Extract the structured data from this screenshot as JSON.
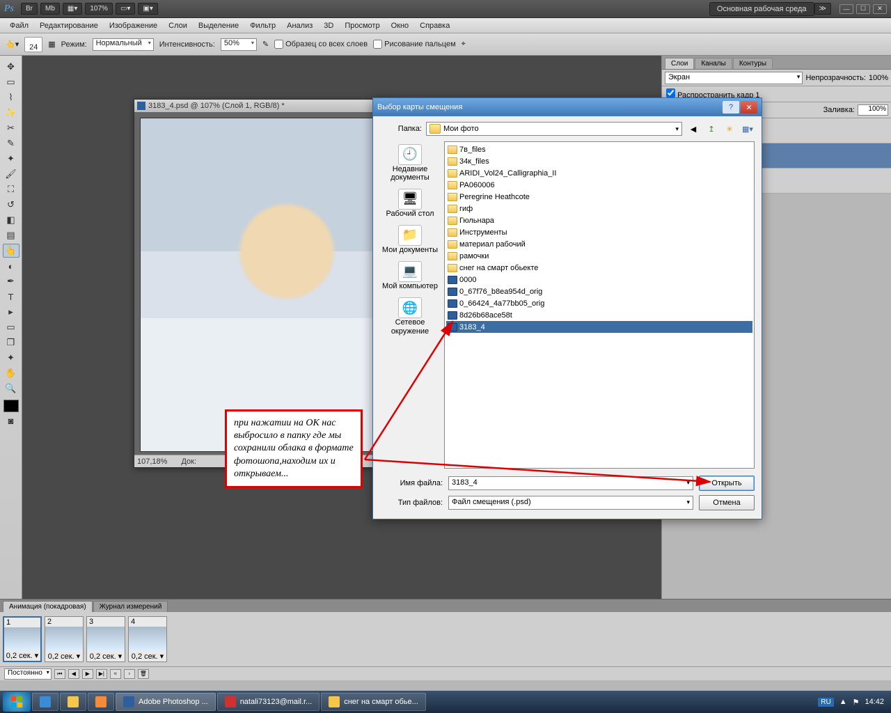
{
  "appbar": {
    "zoom": "107%",
    "workspace": "Основная рабочая среда"
  },
  "menu": [
    "Файл",
    "Редактирование",
    "Изображение",
    "Слои",
    "Выделение",
    "Фильтр",
    "Анализ",
    "3D",
    "Просмотр",
    "Окно",
    "Справка"
  ],
  "options": {
    "brush_size": "24",
    "mode_label": "Режим:",
    "mode_value": "Нормальный",
    "intensity_label": "Интенсивность:",
    "intensity_value": "50%",
    "sample_all": "Образец со всех слоев",
    "finger_paint": "Рисование пальцем"
  },
  "document": {
    "title": "3183_4.psd @ 107% (Слой 1, RGB/8) *",
    "status_zoom": "107,18%",
    "status_label": "Док:"
  },
  "layers_panel": {
    "tabs": [
      "Слои",
      "Каналы",
      "Контуры"
    ],
    "blend_mode": "Экран",
    "opacity_label": "Непрозрачность:",
    "opacity": "100%",
    "propagate": "Распространить кадр 1",
    "fill_label": "Заливка:",
    "fill": "100%",
    "layers": [
      {
        "name": ""
      },
      {
        "name": "",
        "selected": true
      },
      {
        "name": ""
      }
    ]
  },
  "dialog": {
    "title": "Выбор карты смещения",
    "folder_label": "Папка:",
    "folder_value": "Мои фото",
    "places": [
      {
        "icon": "🕘",
        "label": "Недавние документы"
      },
      {
        "icon": "🖥",
        "label": "Рабочий стол"
      },
      {
        "icon": "📁",
        "label": "Мои документы"
      },
      {
        "icon": "💻",
        "label": "Мой компьютер"
      },
      {
        "icon": "🌐",
        "label": "Сетевое окружение"
      }
    ],
    "files": [
      {
        "type": "folder",
        "name": "7в_files"
      },
      {
        "type": "folder",
        "name": "34к_files"
      },
      {
        "type": "folder",
        "name": "ARIDI_Vol24_Calligraphia_II"
      },
      {
        "type": "folder",
        "name": "PA060006"
      },
      {
        "type": "folder",
        "name": "Peregrine Heathcote"
      },
      {
        "type": "folder",
        "name": "гиф"
      },
      {
        "type": "folder",
        "name": "Гюльнара"
      },
      {
        "type": "folder",
        "name": "Инструменты"
      },
      {
        "type": "folder",
        "name": "материал рабочий"
      },
      {
        "type": "folder",
        "name": "рамочки"
      },
      {
        "type": "folder",
        "name": "снег на смарт обьекте"
      },
      {
        "type": "psd",
        "name": "0000"
      },
      {
        "type": "psd",
        "name": "0_67f76_b8ea954d_orig"
      },
      {
        "type": "psd",
        "name": "0_66424_4a77bb05_orig"
      },
      {
        "type": "psd",
        "name": "8d26b68ace58t"
      },
      {
        "type": "psd",
        "name": "3183_4",
        "selected": true
      }
    ],
    "filename_label": "Имя файла:",
    "filename_value": "3183_4",
    "filetype_label": "Тип файлов:",
    "filetype_value": "Файл смещения (.psd)",
    "open": "Открыть",
    "cancel": "Отмена"
  },
  "animation": {
    "tabs": [
      "Анимация (покадровая)",
      "Журнал измерений"
    ],
    "frames": [
      {
        "n": "1",
        "dur": "0,2 сек.",
        "sel": true
      },
      {
        "n": "2",
        "dur": "0,2 сек."
      },
      {
        "n": "3",
        "dur": "0,2 сек."
      },
      {
        "n": "4",
        "dur": "0,2 сек."
      }
    ],
    "loop": "Постоянно"
  },
  "taskbar": {
    "items": [
      {
        "label": "Adobe Photoshop ...",
        "active": true
      },
      {
        "label": "natali73123@mail.r..."
      },
      {
        "label": "снег на смарт обье..."
      }
    ],
    "lang": "RU",
    "time": "14:42"
  },
  "annotation": "при нажатии на ОК нас выбросило в папку где мы сохранили облака в формате фотошопа,находим их и открываем..."
}
